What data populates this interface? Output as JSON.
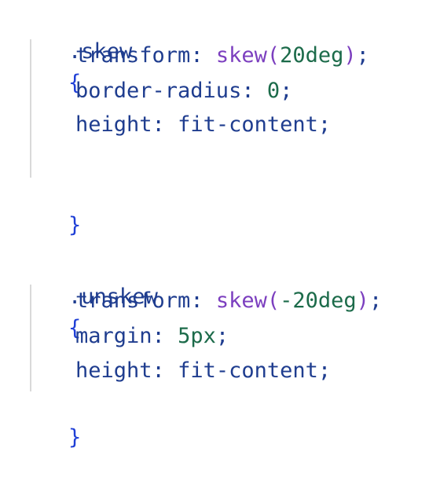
{
  "blocks": [
    {
      "selector": ".skew",
      "open_brace": "{",
      "close_brace": "}",
      "declarations": [
        {
          "property": "transform",
          "colon": ": ",
          "fn": "skew",
          "paren_open": "(",
          "num": "20deg",
          "paren_close": ")",
          "semi": ";"
        },
        {
          "property": "border-radius",
          "colon": ": ",
          "num": "0",
          "semi": ";"
        },
        {
          "property": "height",
          "colon": ": ",
          "value": "fit-content",
          "semi": ";"
        }
      ]
    },
    {
      "selector": ".unskew",
      "open_brace": "{",
      "close_brace": "}",
      "declarations": [
        {
          "property": "transform",
          "colon": ": ",
          "fn": "skew",
          "paren_open": "(",
          "num": "-20deg",
          "paren_close": ")",
          "semi": ";"
        },
        {
          "property": "margin",
          "colon": ": ",
          "num": "5px",
          "semi": ";"
        },
        {
          "property": "height",
          "colon": ": ",
          "value": "fit-content",
          "semi": ";"
        }
      ]
    }
  ],
  "colors": {
    "selector": "#1f3d8f",
    "brace": "#1f3fd6",
    "property": "#1f3d8f",
    "function": "#7c3fbf",
    "number": "#1c6b4a",
    "indent_guide": "#d9d9d9"
  }
}
